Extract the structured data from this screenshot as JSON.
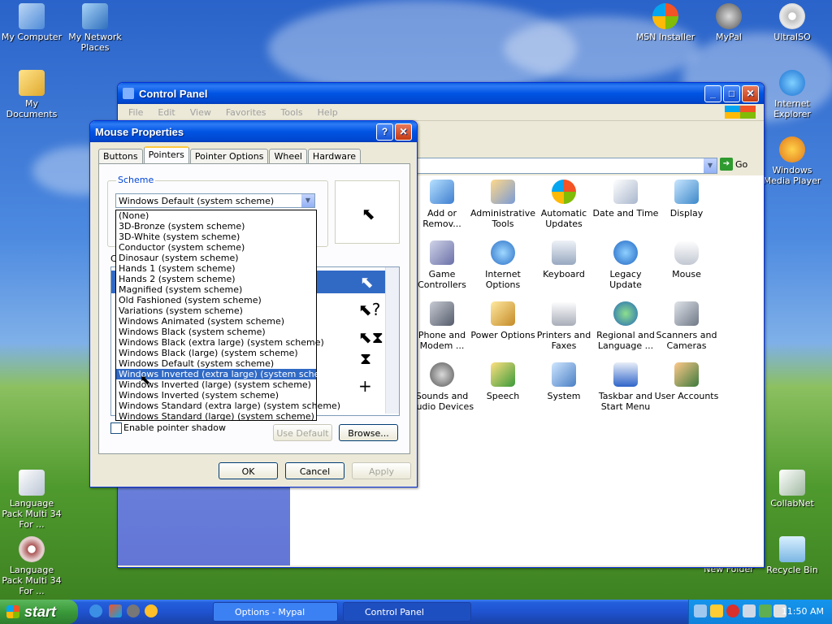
{
  "desktop": {
    "icons": [
      {
        "label": "My Computer"
      },
      {
        "label": "My Network Places"
      },
      {
        "label": "My Documents"
      },
      {
        "label": "MSN Installer"
      },
      {
        "label": "MyPal"
      },
      {
        "label": "UltraISO"
      },
      {
        "label": "Internet Explorer"
      },
      {
        "label": "Windows Media Player"
      },
      {
        "label": "Language Pack Multi 34 For ..."
      },
      {
        "label": "Language Pack Multi 34 For ..."
      },
      {
        "label": "CollabNet"
      },
      {
        "label": "New Folder"
      },
      {
        "label": "Recycle Bin"
      }
    ]
  },
  "control_panel": {
    "title": "Control Panel",
    "menu": [
      "File",
      "Edit",
      "View",
      "Favorites",
      "Tools",
      "Help"
    ],
    "go_label": "Go",
    "items": [
      {
        "label": "Add or Remov..."
      },
      {
        "label": "Administrative Tools"
      },
      {
        "label": "Automatic Updates"
      },
      {
        "label": "Date and Time"
      },
      {
        "label": "Display"
      },
      {
        "label": "Game Controllers"
      },
      {
        "label": "Internet Options"
      },
      {
        "label": "Keyboard"
      },
      {
        "label": "Legacy Update"
      },
      {
        "label": "Mouse"
      },
      {
        "label": "Phone and Modem ..."
      },
      {
        "label": "Power Options"
      },
      {
        "label": "Printers and Faxes"
      },
      {
        "label": "Regional and Language ..."
      },
      {
        "label": "Scanners and Cameras"
      },
      {
        "label": "Sounds and Audio Devices"
      },
      {
        "label": "Speech"
      },
      {
        "label": "System"
      },
      {
        "label": "Taskbar and Start Menu"
      },
      {
        "label": "User Accounts"
      }
    ]
  },
  "mouse_properties": {
    "title": "Mouse Properties",
    "help_button": "?",
    "close_button": "✕",
    "tabs": [
      "Buttons",
      "Pointers",
      "Pointer Options",
      "Wheel",
      "Hardware"
    ],
    "active_tab": "Pointers",
    "scheme_label": "Scheme",
    "customize_label": "C",
    "selected_scheme": "Windows Default (system scheme)",
    "scheme_options": [
      "(None)",
      "3D-Bronze (system scheme)",
      "3D-White (system scheme)",
      "Conductor (system scheme)",
      "Dinosaur (system scheme)",
      "Hands 1 (system scheme)",
      "Hands 2 (system scheme)",
      "Magnified (system scheme)",
      "Old Fashioned (system scheme)",
      "Variations (system scheme)",
      "Windows Animated (system scheme)",
      "Windows Black  (system scheme)",
      "Windows Black (extra large) (system scheme)",
      "Windows Black (large) (system scheme)",
      "Windows Default (system scheme)",
      "Windows Inverted (extra large) (system scheme)",
      "Windows Inverted (large) (system scheme)",
      "Windows Inverted (system scheme)",
      "Windows Standard (extra large) (system scheme)",
      "Windows Standard (large) (system scheme)"
    ],
    "highlighted_option": "Windows Inverted (extra large) (system scheme)",
    "enable_shadow_label": "Enable pointer shadow",
    "use_default_label": "Use Default",
    "browse_label": "Browse...",
    "ok_label": "OK",
    "cancel_label": "Cancel",
    "apply_label": "Apply"
  },
  "taskbar": {
    "start_label": "start",
    "tasks": [
      {
        "label": "Options - Mypal"
      },
      {
        "label": "Control Panel"
      }
    ],
    "clock": "11:50 AM"
  }
}
